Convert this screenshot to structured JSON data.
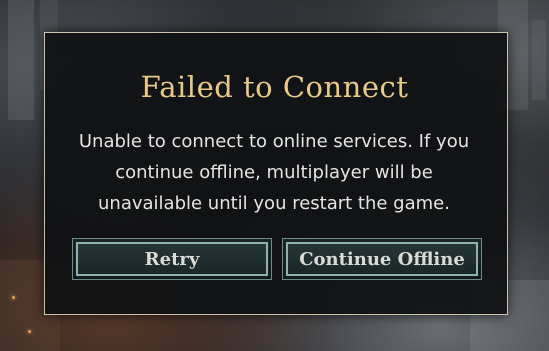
{
  "dialog": {
    "title": "Failed to Connect",
    "message": "Unable to connect to online services. If you continue offline, multiplayer will be unavailable until you restart the game.",
    "buttons": {
      "retry_label": "Retry",
      "continue_offline_label": "Continue Offline"
    }
  },
  "colors": {
    "title": "#e8c987",
    "message": "#e4e4e0",
    "dialog_border": "#c9c2a8",
    "button_border": "#8fb2ae",
    "button_text": "#d9dcd6"
  }
}
